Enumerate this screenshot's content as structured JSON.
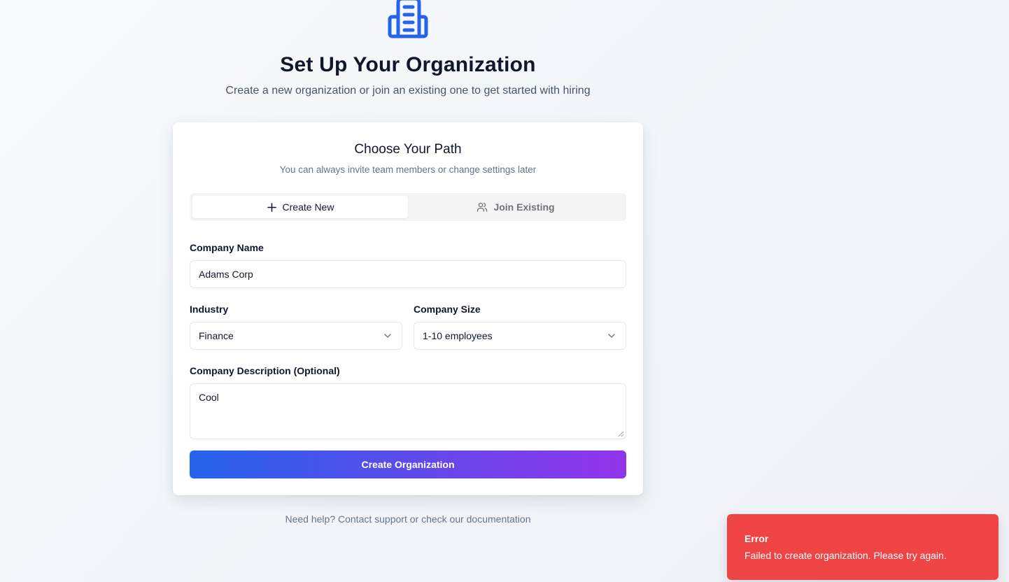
{
  "header": {
    "icon": "building-icon",
    "title": "Set Up Your Organization",
    "subtitle": "Create a new organization or join an existing one to get started with hiring"
  },
  "card": {
    "title": "Choose Your Path",
    "subtitle": "You can always invite team members or change settings later",
    "tabs": [
      {
        "label": "Create New",
        "icon": "plus-icon",
        "active": true
      },
      {
        "label": "Join Existing",
        "icon": "users-icon",
        "active": false
      }
    ],
    "form": {
      "company_name": {
        "label": "Company Name",
        "value": "Adams Corp"
      },
      "industry": {
        "label": "Industry",
        "value": "Finance"
      },
      "company_size": {
        "label": "Company Size",
        "value": "1-10 employees"
      },
      "description": {
        "label": "Company Description (Optional)",
        "value": "Cool"
      }
    },
    "submit_label": "Create Organization"
  },
  "footer": {
    "help_text": "Need help? Contact support or check our documentation"
  },
  "toast": {
    "title": "Error",
    "message": "Failed to create organization. Please try again."
  },
  "colors": {
    "accent_start": "#2563eb",
    "accent_end": "#9333ea",
    "error": "#ef4444"
  }
}
